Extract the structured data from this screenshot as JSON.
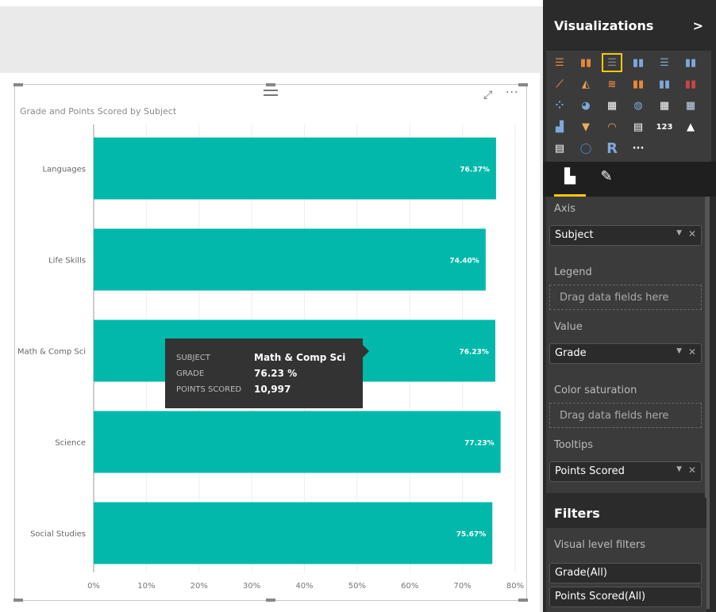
{
  "visual": {
    "title": "Grade and Points Scored by Subject"
  },
  "chart_data": {
    "type": "bar",
    "orientation": "horizontal",
    "title": "Grade and Points Scored by Subject",
    "categories": [
      "Languages",
      "Life Skills",
      "Math & Comp Sci",
      "Science",
      "Social Studies"
    ],
    "values": [
      76.37,
      74.4,
      76.23,
      77.23,
      75.67
    ],
    "data_labels": [
      "76.37%",
      "74.40%",
      "76.23%",
      "77.23%",
      "75.67%"
    ],
    "xlim": [
      0,
      80
    ],
    "xticks": [
      "0%",
      "10%",
      "20%",
      "30%",
      "40%",
      "50%",
      "60%",
      "70%",
      "80%"
    ],
    "grid": true,
    "bar_color": "#01b8aa"
  },
  "tooltip": {
    "rows": [
      {
        "key": "SUBJECT",
        "value": "Math & Comp Sci"
      },
      {
        "key": "GRADE",
        "value": "76.23 %"
      },
      {
        "key": "POINTS SCORED",
        "value": "10,997"
      }
    ]
  },
  "pane": {
    "title": "Visualizations",
    "more": "···",
    "wells": {
      "axis_label": "Axis",
      "axis_field": "Subject",
      "legend_label": "Legend",
      "legend_placeholder": "Drag data fields here",
      "value_label": "Value",
      "value_field": "Grade",
      "color_label": "Color saturation",
      "color_placeholder": "Drag data fields here",
      "tooltips_label": "Tooltips",
      "tooltips_field": "Points Scored"
    },
    "filters": {
      "title": "Filters",
      "visual_level": "Visual level filters",
      "items": [
        "Grade(All)",
        "Points Scored(All)"
      ]
    }
  }
}
